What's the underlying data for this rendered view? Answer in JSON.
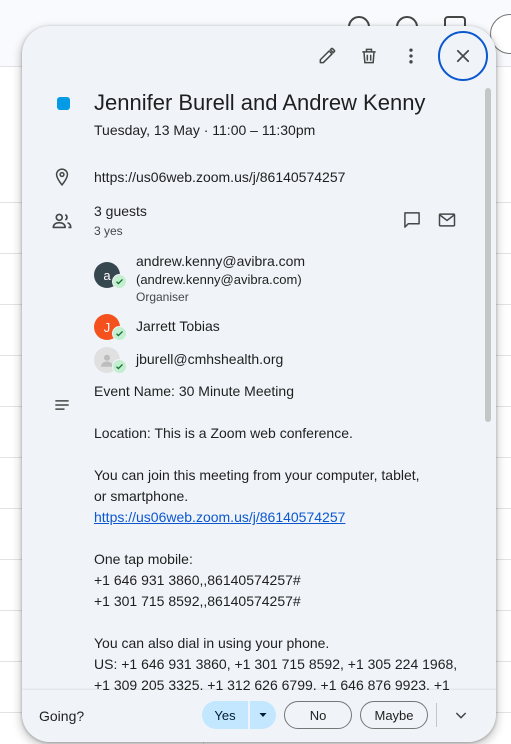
{
  "event": {
    "title": "Jennifer Burell and Andrew Kenny",
    "datetime": "Tuesday, 13 May  ·  11:00 – 11:30pm",
    "color": "#039be5",
    "location": "https://us06web.zoom.us/j/86140574257"
  },
  "guests": {
    "summary": "3 guests",
    "yes_count": "3 yes",
    "list": [
      {
        "avatar_initial": "a",
        "avatar_color": "#37474f",
        "name": "andrew.kenny@avibra.com",
        "email": "(andrew.kenny@avibra.com)",
        "role": "Organiser"
      },
      {
        "avatar_initial": "J",
        "avatar_color": "#f4511e",
        "name": "Jarrett Tobias"
      },
      {
        "avatar_initial": "",
        "avatar_color": "#e0e0e0",
        "name": "jburell@cmhshealth.org"
      }
    ]
  },
  "description": {
    "event_name": "Event Name: 30 Minute Meeting",
    "location_line": "Location: This is a Zoom web conference.",
    "join_line1": "You can join this meeting from your computer, tablet,",
    "join_line2": "or smartphone.",
    "join_link": "https://us06web.zoom.us/j/86140574257",
    "one_tap": "One tap mobile:",
    "tap1": "+1 646 931 3860,,86140574257#",
    "tap2": "+1 301 715 8592,,86140574257#",
    "dial_in": "You can also dial in using your phone.",
    "us_line1": "US: +1 646 931 3860, +1 301 715 8592, +1 305 224 1968,",
    "us_line2": "+1 309 205 3325, +1 312 626 6799, +1 646 876 9923, +1"
  },
  "rsvp": {
    "prompt": "Going?",
    "yes": "Yes",
    "no": "No",
    "maybe": "Maybe"
  },
  "icons": {
    "edit": "pencil-icon",
    "delete": "trash-icon",
    "more": "more-vert-icon",
    "close": "close-icon",
    "location": "location-pin-icon",
    "guests": "people-icon",
    "chat": "chat-icon",
    "email": "mail-icon",
    "description": "notes-icon"
  },
  "colors": {
    "accent": "#0b57d0",
    "rsvp_selected": "#c2e7ff",
    "confirmed": "#c4eed0"
  }
}
